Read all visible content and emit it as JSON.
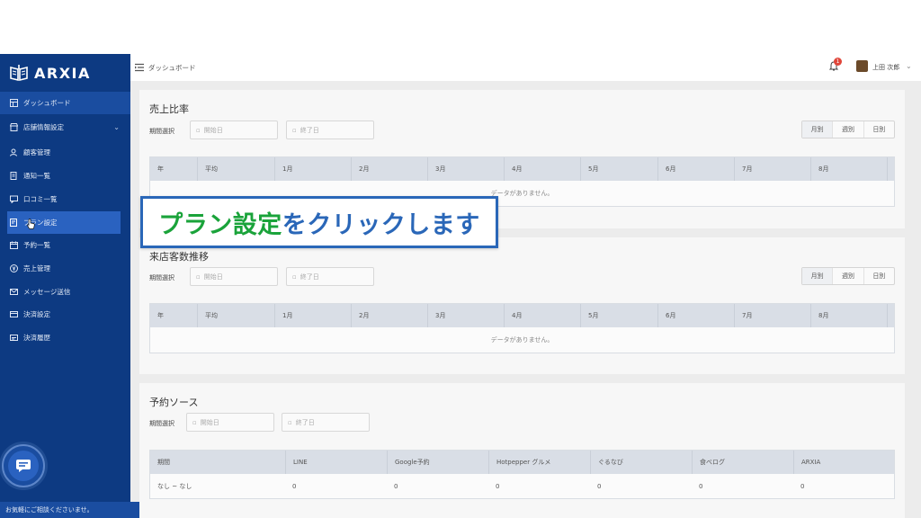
{
  "brand": {
    "name": "ARXIA"
  },
  "sidebar": {
    "items": [
      {
        "label": "ダッシュボード",
        "icon": "dashboard-icon"
      },
      {
        "label": "店舗情報設定",
        "icon": "store-icon",
        "expandable": true
      },
      {
        "label": "顧客管理",
        "icon": "customers-icon"
      },
      {
        "label": "通知一覧",
        "icon": "notification-list-icon"
      },
      {
        "label": "口コミ一覧",
        "icon": "review-icon"
      },
      {
        "label": "プラン設定",
        "icon": "plan-icon"
      },
      {
        "label": "予約一覧",
        "icon": "reservation-icon"
      },
      {
        "label": "売上管理",
        "icon": "sales-icon"
      },
      {
        "label": "メッセージ送信",
        "icon": "message-icon"
      },
      {
        "label": "決済設定",
        "icon": "payment-settings-icon"
      },
      {
        "label": "決済履歴",
        "icon": "payment-history-icon"
      }
    ],
    "consult_text": "お気軽にご相談くださいませ。"
  },
  "header": {
    "breadcrumb": "ダッシュボード",
    "notification_count": "1",
    "user_name": "上田 次郎"
  },
  "sales_ratio": {
    "title": "売上比率",
    "period_label": "期間選択",
    "start_placeholder": "開始日",
    "end_placeholder": "終了日",
    "segments": [
      "月別",
      "週別",
      "日別"
    ],
    "columns": [
      "年",
      "平均",
      "1月",
      "2月",
      "3月",
      "4月",
      "5月",
      "6月",
      "7月",
      "8月"
    ],
    "empty_text": "データがありません。"
  },
  "visitor_trend": {
    "title": "来店客数推移",
    "period_label": "期間選択",
    "start_placeholder": "開始日",
    "end_placeholder": "終了日",
    "segments": [
      "月別",
      "週別",
      "日別"
    ],
    "columns": [
      "年",
      "平均",
      "1月",
      "2月",
      "3月",
      "4月",
      "5月",
      "6月",
      "7月",
      "8月"
    ],
    "empty_text": "データがありません。"
  },
  "reservation_source": {
    "title": "予約ソース",
    "period_label": "期間選択",
    "start_placeholder": "開始日",
    "end_placeholder": "終了日",
    "columns": [
      "期間",
      "LINE",
      "Google予約",
      "Hotpepper グルメ",
      "ぐるなび",
      "食べログ",
      "ARXIA"
    ],
    "row": [
      "なし ~ なし",
      "0",
      "0",
      "0",
      "0",
      "0",
      "0"
    ]
  },
  "callout": {
    "highlight": "プラン設定",
    "rest": "をクリックします"
  },
  "colors": {
    "sidebar_bg": "#0d3a82",
    "sidebar_active": "#1a4da0",
    "callout_green": "#1aa33a",
    "callout_blue": "#2a67b8"
  }
}
